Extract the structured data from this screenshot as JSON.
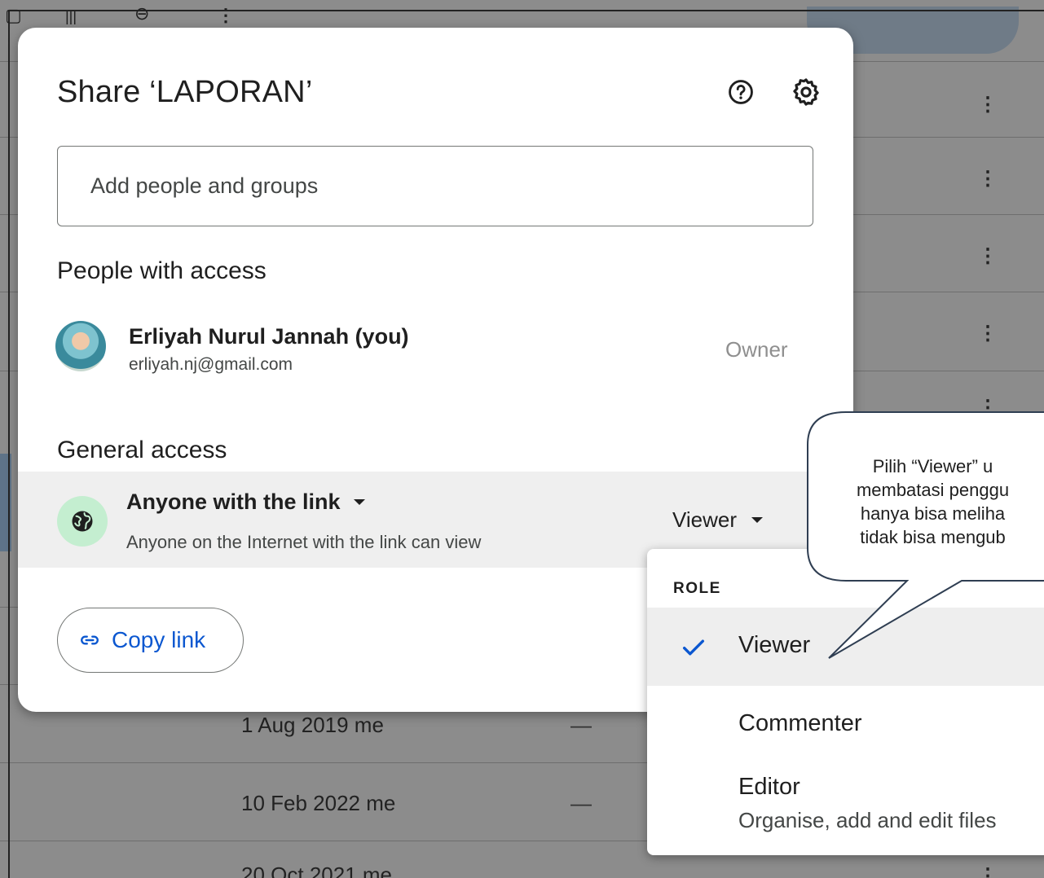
{
  "dialog": {
    "title": "Share ‘LAPORAN’",
    "add_placeholder": "Add people and groups",
    "people_section": "People with access",
    "person": {
      "name": "Erliyah Nurul Jannah (you)",
      "email": "erliyah.nj@gmail.com",
      "role": "Owner"
    },
    "general_section": "General access",
    "general_access": {
      "label": "Anyone with the link",
      "description": "Anyone on the Internet with the link can view",
      "role": "Viewer"
    },
    "copy_link": "Copy link"
  },
  "role_menu": {
    "header": "ROLE",
    "items": [
      {
        "label": "Viewer",
        "selected": true
      },
      {
        "label": "Commenter",
        "selected": false
      },
      {
        "label": "Editor",
        "description": "Organise, add and edit files",
        "selected": false
      }
    ]
  },
  "background_list": {
    "rows": [
      {
        "date": "1 Aug 2019 me",
        "size": "—"
      },
      {
        "date": "10 Feb 2022 me",
        "size": "—"
      },
      {
        "date": "20 Oct 2021 me",
        "size": ""
      }
    ]
  },
  "callout": {
    "lines": [
      "Pilih “Viewer” u",
      "membatasi penggu",
      "hanya bisa meliha",
      "tidak bisa mengub"
    ]
  },
  "colors": {
    "accent": "#0b57d0",
    "globe_bg": "#c4eed0",
    "overlay": "#8c8c8c"
  }
}
